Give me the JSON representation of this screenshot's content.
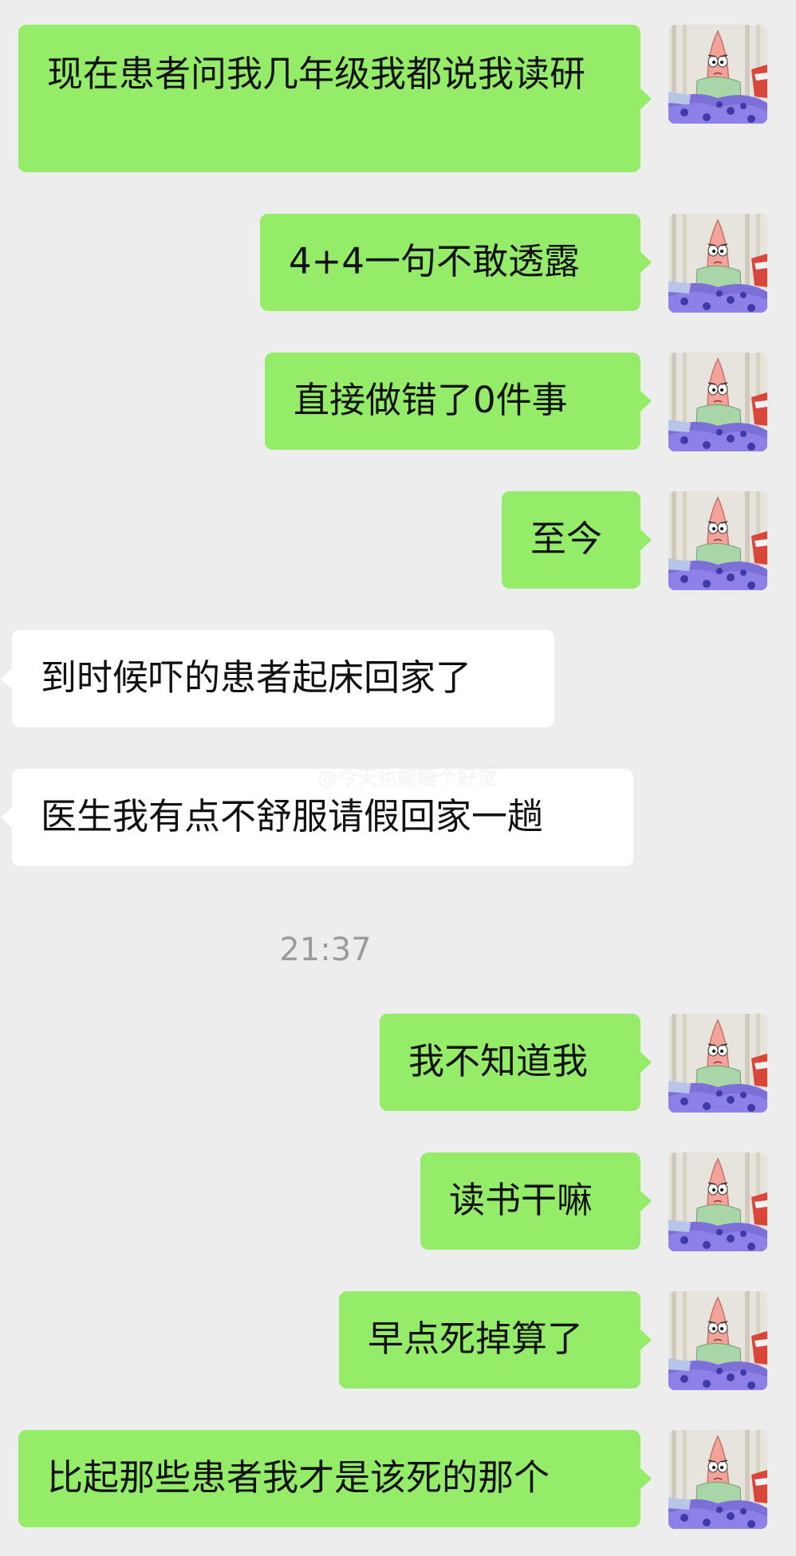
{
  "chat": {
    "messages": [
      {
        "side": "sent",
        "text": "现在患者问我几年级我都说我读研"
      },
      {
        "side": "sent",
        "text": "4+4一句不敢透露"
      },
      {
        "side": "sent",
        "text": "直接做错了0件事"
      },
      {
        "side": "sent",
        "text": "至今"
      },
      {
        "side": "received",
        "text": "到时候吓的患者起床回家了"
      },
      {
        "side": "received",
        "text": "医生我有点不舒服请假回家一趟"
      },
      {
        "side": "sent",
        "text": "我不知道我"
      },
      {
        "side": "sent",
        "text": "读书干嘛"
      },
      {
        "side": "sent",
        "text": "早点死掉算了"
      },
      {
        "side": "sent",
        "text": "比起那些患者我才是该死的那个"
      }
    ],
    "timestamp": "21:37",
    "watermark": "@今天也能睡个好觉",
    "avatar_icon": "patrick-star-avatar-icon",
    "watermark_icon": "weibo-icon",
    "colors": {
      "background": "#ededed",
      "sent_bubble": "#95ec69",
      "received_bubble": "#ffffff",
      "timestamp_text": "#9b9b9b"
    }
  }
}
